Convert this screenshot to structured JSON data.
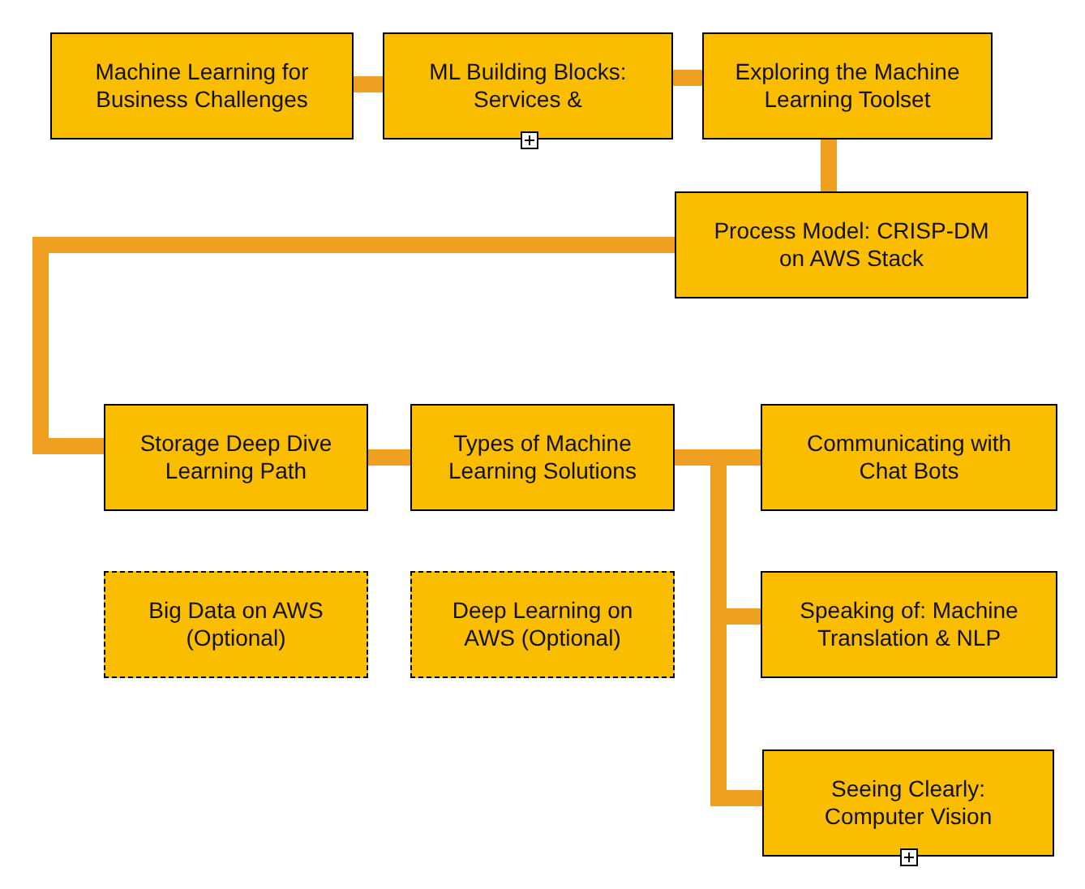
{
  "nodes": [
    {
      "label": "Machine Learning for Business Challenges",
      "kind": "solid",
      "expandable": false
    },
    {
      "label": "ML Building Blocks: Services &",
      "kind": "solid",
      "expandable": true
    },
    {
      "label": "Exploring the Machine Learning Toolset",
      "kind": "solid",
      "expandable": false
    },
    {
      "label": "Process Model: CRISP-DM on AWS Stack",
      "kind": "solid",
      "expandable": false
    },
    {
      "label": "Storage Deep Dive Learning Path",
      "kind": "solid",
      "expandable": false
    },
    {
      "label": "Types of Machine Learning Solutions",
      "kind": "solid",
      "expandable": false
    },
    {
      "label": "Communicating with Chat Bots",
      "kind": "solid",
      "expandable": false
    },
    {
      "label": "Big Data on AWS (Optional)",
      "kind": "optional",
      "expandable": false
    },
    {
      "label": "Deep Learning on AWS (Optional)",
      "kind": "optional",
      "expandable": false
    },
    {
      "label": "Speaking of: Machine Translation & NLP",
      "kind": "solid",
      "expandable": false
    },
    {
      "label": "Seeing Clearly: Computer Vision",
      "kind": "solid",
      "expandable": true
    }
  ]
}
